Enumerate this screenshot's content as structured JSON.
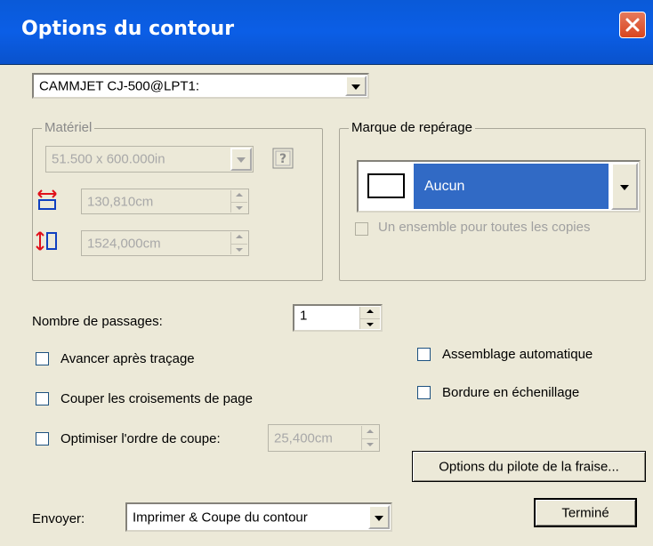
{
  "window": {
    "title": "Options du contour"
  },
  "device": {
    "selected": "CAMMJET CJ-500@LPT1:"
  },
  "material": {
    "label": "Matériel",
    "size": "51.500 x 600.000in",
    "width": "130,810cm",
    "height": "1524,000cm",
    "help_icon": "help-icon",
    "width_icon": "width-icon",
    "height_icon": "height-icon"
  },
  "registration": {
    "label": "Marque de repérage",
    "selected": "Aucun",
    "one_set_label": "Un ensemble pour toutes les copies"
  },
  "passes": {
    "label": "Nombre de passages:",
    "value": "1"
  },
  "options": {
    "advance_after_plot": "Avancer après traçage",
    "cut_page_crossings": "Couper les croisements de page",
    "optimize_cut_order": "Optimiser l'ordre de coupe:",
    "optimize_value": "25,400cm",
    "auto_assembly": "Assemblage automatique",
    "weed_border": "Bordure en échenillage"
  },
  "buttons": {
    "driver_options": "Options du pilote de la fraise...",
    "done": "Terminé"
  },
  "send": {
    "label": "Envoyer:",
    "selected": "Imprimer & Coupe du contour"
  },
  "colors": {
    "titlebar": "#0a5ad8",
    "selection": "#316ac5",
    "dialog_bg": "#ece9d8",
    "accent_icon": "#e0101a"
  }
}
